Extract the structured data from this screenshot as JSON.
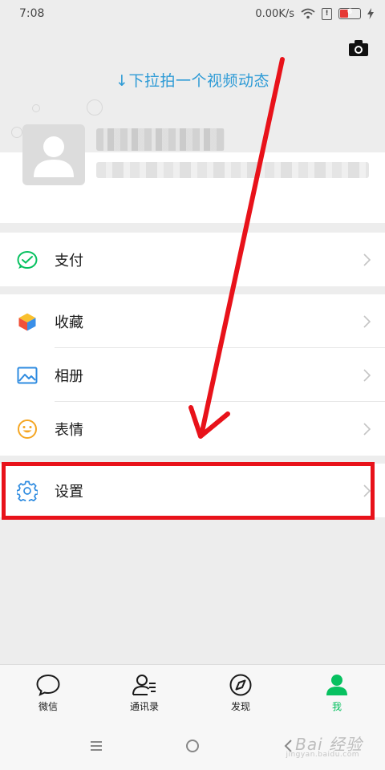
{
  "status_bar": {
    "time": "7:08",
    "speed": "0.00K/s",
    "battery_level": "6",
    "colors": {
      "battery_low": "#e53935"
    }
  },
  "header": {
    "pull_hint": "↓下拉拍一个视频动态",
    "camera_icon": "camera-icon"
  },
  "profile": {
    "avatar_icon": "default-avatar-icon"
  },
  "menu": {
    "pay": {
      "label": "支付",
      "icon": "wallet-icon"
    },
    "favorites": {
      "label": "收藏",
      "icon": "cube-icon"
    },
    "album": {
      "label": "相册",
      "icon": "picture-icon"
    },
    "stickers": {
      "label": "表情",
      "icon": "smiley-icon"
    },
    "settings": {
      "label": "设置",
      "icon": "gear-icon"
    }
  },
  "tab_bar": {
    "tabs": [
      {
        "label": "微信",
        "icon": "chat-bubble-icon",
        "active": false
      },
      {
        "label": "通讯录",
        "icon": "contacts-icon",
        "active": false
      },
      {
        "label": "发现",
        "icon": "compass-icon",
        "active": false
      },
      {
        "label": "我",
        "icon": "person-icon",
        "active": true
      }
    ],
    "colors": {
      "active": "#07c160"
    }
  },
  "watermark": {
    "logo": "Bai 经验",
    "sub": "jingyan.baidu.com"
  },
  "colors": {
    "accent_green": "#07c160",
    "hint_blue": "#2e9bd6",
    "annotation_red": "#e8121a"
  }
}
